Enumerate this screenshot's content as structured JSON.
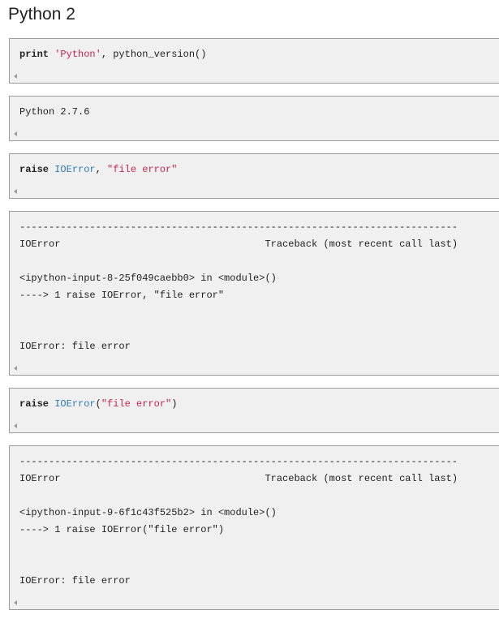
{
  "heading": "Python 2",
  "cells": [
    {
      "type": "input",
      "keyword": "raise",
      "print_keyword": "print",
      "parts": [
        "print",
        " ",
        "'Python'",
        ", python_version()"
      ]
    }
  ],
  "cell1": {
    "kw": "print",
    "sp": " ",
    "str": "'Python'",
    "rest": ", python_version()"
  },
  "cell2": {
    "text": "Python 2.7.6"
  },
  "cell3": {
    "kw": "raise",
    "sp": " ",
    "name": "IOError",
    "comma": ", ",
    "str": "\"file error\""
  },
  "cell4": {
    "dashes": "---------------------------------------------------------------------------",
    "err_header": "IOError                                   Traceback (most recent call last)",
    "location": "<ipython-input-8-25f049caebb0> in <module>()",
    "arrow_line": "----> 1 raise IOError, \"file error\"",
    "blank1": "",
    "blank2": "",
    "message": "IOError: file error"
  },
  "cell5": {
    "kw": "raise",
    "sp": " ",
    "name": "IOError",
    "open": "(",
    "str": "\"file error\"",
    "close": ")"
  },
  "cell6": {
    "dashes": "---------------------------------------------------------------------------",
    "err_header": "IOError                                   Traceback (most recent call last)",
    "location": "<ipython-input-9-6f1c43f525b2> in <module>()",
    "arrow_line": "----> 1 raise IOError(\"file error\")",
    "blank1": "",
    "blank2": "",
    "message": "IOError: file error"
  }
}
